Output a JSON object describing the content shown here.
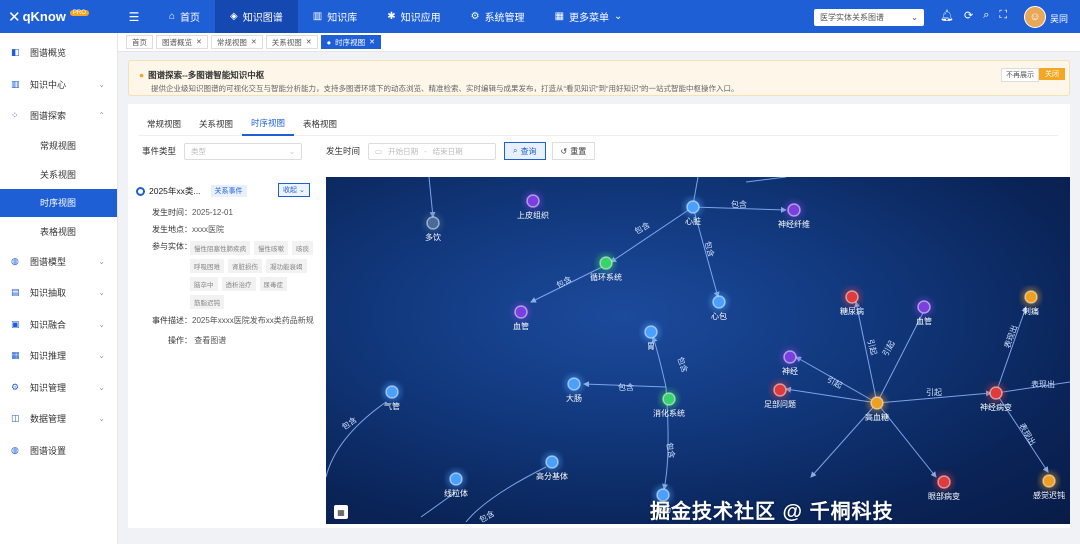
{
  "header": {
    "logo_text": "qKnow",
    "logo_badge": "PRO",
    "nav": [
      {
        "label": "首页",
        "icon": "home-icon"
      },
      {
        "label": "知识图谱",
        "icon": "graph-icon",
        "active": true
      },
      {
        "label": "知识库",
        "icon": "book-icon"
      },
      {
        "label": "知识应用",
        "icon": "app-icon"
      },
      {
        "label": "系统管理",
        "icon": "settings-icon"
      },
      {
        "label": "更多菜单",
        "icon": "grid-icon"
      }
    ],
    "search_value": "医学实体关系图谱",
    "username": "吴同"
  },
  "sidebar": {
    "items": [
      {
        "label": "图谱概览"
      },
      {
        "label": "知识中心"
      },
      {
        "label": "图谱探索"
      },
      {
        "label": "常规视图"
      },
      {
        "label": "关系视图"
      },
      {
        "label": "时序视图"
      },
      {
        "label": "表格视图"
      },
      {
        "label": "图谱模型"
      },
      {
        "label": "知识抽取"
      },
      {
        "label": "知识融合"
      },
      {
        "label": "知识推理"
      },
      {
        "label": "知识管理"
      },
      {
        "label": "数据管理"
      },
      {
        "label": "图谱设置"
      }
    ]
  },
  "tabs": [
    "首页",
    "图谱概览",
    "常规视图",
    "关系视图",
    "时序视图"
  ],
  "notice": {
    "title": "图谱探索--多图谱智能知识中枢",
    "desc": "提供企业级知识图谱的可视化交互与智能分析能力，支持多图谱环境下的动态浏览、精准检索、实时编辑与成果发布，打造从“看见知识”到“用好知识”的一站式智能中枢操作入口。",
    "btn_hide": "不再展示",
    "btn_close": "关闭"
  },
  "views": [
    "常规视图",
    "关系视图",
    "时序视图",
    "表格视图"
  ],
  "filters": {
    "event_type_label": "事件类型",
    "event_type_placeholder": "类型",
    "time_label": "发生时间",
    "start_placeholder": "开始日期",
    "end_placeholder": "结束日期",
    "query": "查询",
    "reset": "重置"
  },
  "timeline": {
    "title": "2025年xx类...",
    "badge": "关系事件",
    "collapse": "收起",
    "time_label": "发生时间：",
    "time": "2025-12-01",
    "place_label": "发生地点：",
    "place": "xxxx医院",
    "entities_label": "参与实体：",
    "entities": [
      "慢性阻塞性肺疾病",
      "慢性咳嗽",
      "咳痰",
      "呼吸困难",
      "肾脏损伤",
      "凝功能衰竭",
      "脑卒中",
      "透析治疗",
      "尿毒症",
      "筋脂迟钝"
    ],
    "desc_label": "事件描述：",
    "desc": "2025年xxxx医院发布xx类药品新规",
    "op_label": "操作：",
    "op": "查看图谱"
  },
  "graph": {
    "nodes": [
      "多饮",
      "上皮组织",
      "心脏",
      "神经纤维",
      "循环系统",
      "心包",
      "血管",
      "糖尿病",
      "血管",
      "刺痛",
      "胃",
      "神经",
      "大肠",
      "消化系统",
      "足部问题",
      "高血糖",
      "神经病变",
      "气管",
      "高分基体",
      "线粒体",
      "小肠",
      "眼部病变",
      "感觉迟钝"
    ],
    "edges": [
      "包含",
      "包含",
      "包含",
      "包含",
      "包含",
      "包含",
      "包含",
      "包含",
      "引起",
      "引起",
      "引起",
      "引起",
      "表现出",
      "表现出",
      "表现出",
      "包含"
    ]
  },
  "watermark": "掘金技术社区 @ 千桐科技",
  "colors": {
    "primary": "#1f5fd6",
    "warning": "#f5a623",
    "graph_bg": "#0f2f6e"
  }
}
